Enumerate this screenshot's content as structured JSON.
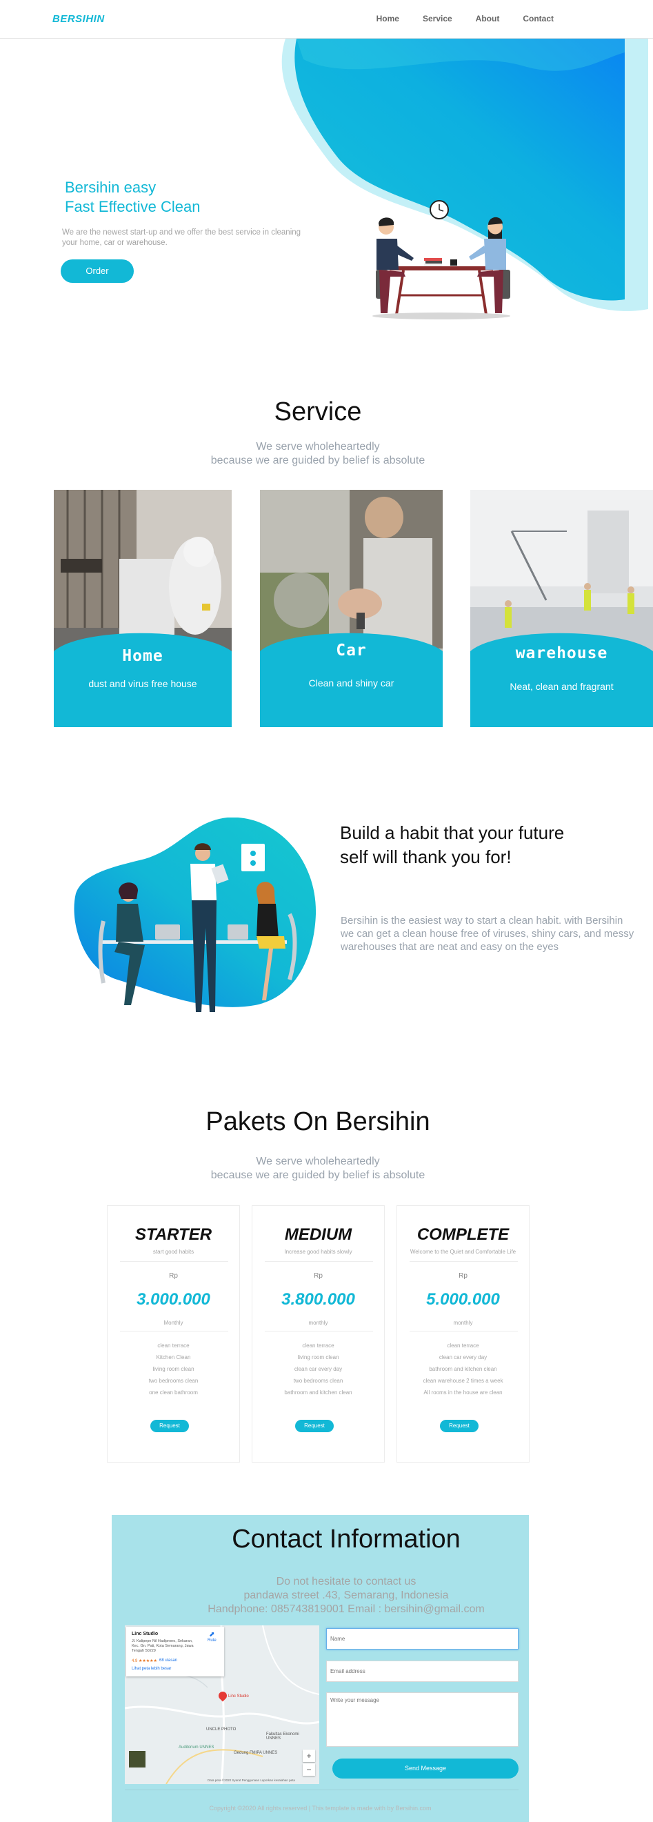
{
  "navbar": {
    "brand": "BERSIHIN",
    "links": [
      "Home",
      "Service",
      "About",
      "Contact"
    ]
  },
  "hero": {
    "title_line1": "Bersihin easy",
    "title_line2": "Fast Effective Clean",
    "description": "We are the newest start-up and we offer the best service in cleaning your home, car or warehouse.",
    "button": "Order"
  },
  "service": {
    "title": "Service",
    "subtitle_line1": "We serve wholeheartedly",
    "subtitle_line2": "because we are guided by belief is absolute",
    "cards": [
      {
        "name": "Home",
        "desc": "dust and virus free house"
      },
      {
        "name": "Car",
        "desc": "Clean and shiny car"
      },
      {
        "name": "warehouse",
        "desc": "Neat, clean and fragrant"
      }
    ]
  },
  "habit": {
    "title": "Build a habit that your future self will thank you for!",
    "text": "Bersihin is the easiest way to start a clean habit. with Bersihin we can get a clean house free of viruses, shiny cars, and messy warehouses that are neat and easy on the eyes"
  },
  "pakets": {
    "title": "Pakets On Bersihin",
    "subtitle_line1": "We serve wholeheartedly",
    "subtitle_line2": "because we are guided by belief is absolute",
    "plans": [
      {
        "name": "STARTER",
        "tagline": "start good habits",
        "currency": "Rp",
        "price": "3.000.000",
        "period": "Monthly",
        "features": [
          "clean terrace",
          "Kitchen Clean",
          "living room clean",
          "two bedrooms clean",
          "one clean bathroom"
        ],
        "button": "Request"
      },
      {
        "name": "MEDIUM",
        "tagline": "Increase good habits slowly",
        "currency": "Rp",
        "price": "3.800.000",
        "period": "monthly",
        "features": [
          "clean terrace",
          "living room clean",
          "clean car every day",
          "two bedrooms clean",
          "bathroom and kitchen clean"
        ],
        "button": "Request"
      },
      {
        "name": "COMPLETE",
        "tagline": "Welcome to the Quiet and Comfortable Life",
        "currency": "Rp",
        "price": "5.000.000",
        "period": "monthly",
        "features": [
          "clean terrace",
          "clean car every day",
          "bathroom and kitchen clean",
          "clean warehouse 2 times a week",
          "All rooms in the house are clean"
        ],
        "button": "Request"
      }
    ]
  },
  "contact": {
    "title": "Contact Information",
    "line1": "Do not hesitate to contact us",
    "line2": "pandawa street .43, Semarang, Indonesia",
    "line3": "Handphone: 085743819001 Email : bersihin@gmail.com",
    "map": {
      "place": "Linc Studio",
      "address": "Jl. Kalipepe Nil Hadiprono, Sekaran, Kec. Gn. Pati, Kota Semarang, Jawa Tengah 50229",
      "rating": "4.9 ★★★★★",
      "reviews": "68 ulasan",
      "larger": "Lihat peta lebih besar",
      "route": "Rute",
      "labels": [
        "Linc Studio",
        "UNCLE PHOTO",
        "Fakultas Ekonomi UNNES",
        "Auditorium UNNES",
        "Gedung FMIPA UNNES"
      ],
      "footer": "Data peta ©2020  Syarat Penggunaan  Laporkan kesalahan peta"
    },
    "name_placeholder": "Name",
    "email_placeholder": "Email address",
    "message_placeholder": "Write your message",
    "send": "Send Message",
    "copyright": "Copyright ©2020 All rights reserved | This template is made with by Bersihin.com"
  },
  "colors": {
    "accent": "#12b8d6",
    "accent_dark": "#0a85e0",
    "contact_bg": "#a8e2ea"
  }
}
